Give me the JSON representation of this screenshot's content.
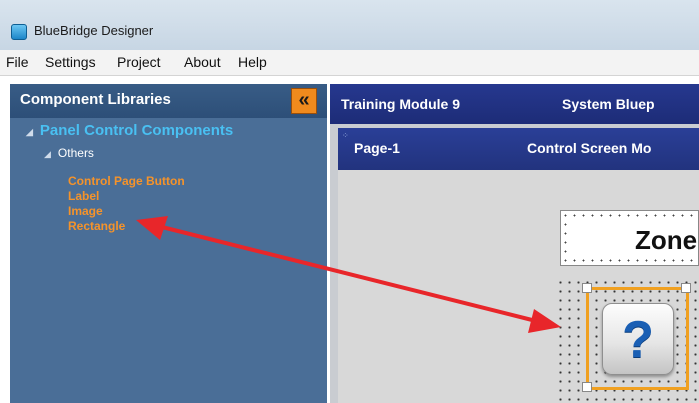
{
  "app": {
    "title": "BlueBridge Designer"
  },
  "menu": [
    "File",
    "Settings",
    "Project",
    "About",
    "Help"
  ],
  "left_panel": {
    "title": "Component Libraries",
    "collapse_glyph": "«",
    "tree_root": "Panel Control Components",
    "tree_sub": "Others",
    "leaves": [
      "Control Page Button",
      "Label",
      "Image",
      "Rectangle"
    ]
  },
  "right_panel": {
    "header_left": "Training Module 9",
    "header_right": "System Bluep",
    "page_left": "Page-1",
    "page_right": "Control Screen Mo",
    "zone_label": "Zone",
    "image_symbol": "?"
  },
  "colors": {
    "accent_orange": "#f5932a",
    "tree_root_blue": "#49c0f2",
    "header_navy": "#26388f",
    "arrow_red": "#e8262a"
  },
  "icons": [
    "app-icon",
    "collapse-chevron-icon",
    "question-mark-icon",
    "double-arrow-annotation"
  ]
}
